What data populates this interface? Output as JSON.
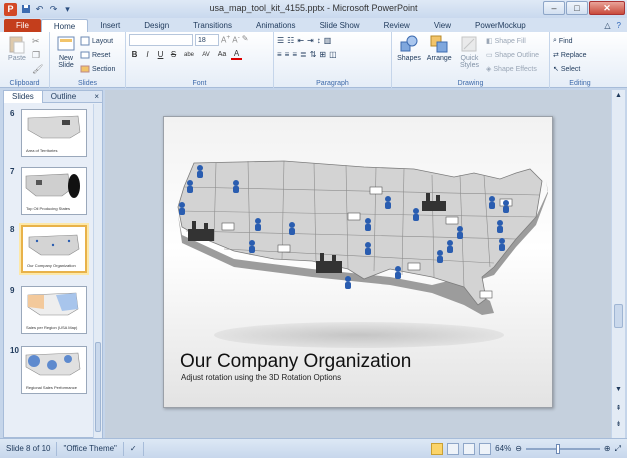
{
  "titlebar": {
    "title": "usa_map_tool_kit_4155.pptx - Microsoft PowerPoint",
    "app_icon": "P",
    "qat": [
      "save-icon",
      "undo-icon",
      "redo-icon",
      "customize-icon"
    ],
    "minimize": "–",
    "maximize": "□",
    "close": "✕"
  },
  "tabs": [
    "Home",
    "Insert",
    "Design",
    "Transitions",
    "Animations",
    "Slide Show",
    "Review",
    "View",
    "PowerMockup"
  ],
  "file_tab": "File",
  "active_tab": "Home",
  "ribbon": {
    "clipboard": {
      "label": "Clipboard",
      "paste": "Paste"
    },
    "slides": {
      "label": "Slides",
      "new_slide": "New Slide",
      "layout": "Layout",
      "reset": "Reset",
      "section": "Section"
    },
    "font": {
      "label": "Font",
      "size": "18",
      "bold": "B",
      "italic": "I",
      "underline": "U",
      "strike": "S",
      "shadow": "abe",
      "spacing": "AV",
      "case": "Aa",
      "color": "A"
    },
    "paragraph": {
      "label": "Paragraph"
    },
    "drawing": {
      "label": "Drawing",
      "shapes": "Shapes",
      "arrange": "Arrange",
      "quick_styles": "Quick Styles",
      "shape_fill": "Shape Fill",
      "shape_outline": "Shape Outline",
      "shape_effects": "Shape Effects"
    },
    "editing": {
      "label": "Editing",
      "find": "Find",
      "replace": "Replace",
      "select": "Select"
    }
  },
  "leftpanel": {
    "tab_slides": "Slides",
    "tab_outline": "Outline",
    "close": "×",
    "thumbs": [
      {
        "num": "6",
        "caption": "Area of Territories"
      },
      {
        "num": "7",
        "caption": "Top Oil Producing States"
      },
      {
        "num": "8",
        "caption": "Our Company Organization"
      },
      {
        "num": "9",
        "caption": "Sales per Region (USA Map)"
      },
      {
        "num": "10",
        "caption": "Regional Sales Performance"
      }
    ]
  },
  "slide": {
    "title": "Our Company Organization",
    "subtitle": "Adjust rotation using the 3D Rotation Options"
  },
  "statusbar": {
    "slide_info": "Slide 8 of 10",
    "theme": "\"Office Theme\"",
    "zoom": "64%"
  },
  "colors": {
    "file_tab": "#c43e1c",
    "selected_thumb": "#e8b24a",
    "marker_blue": "#2a5db0"
  }
}
